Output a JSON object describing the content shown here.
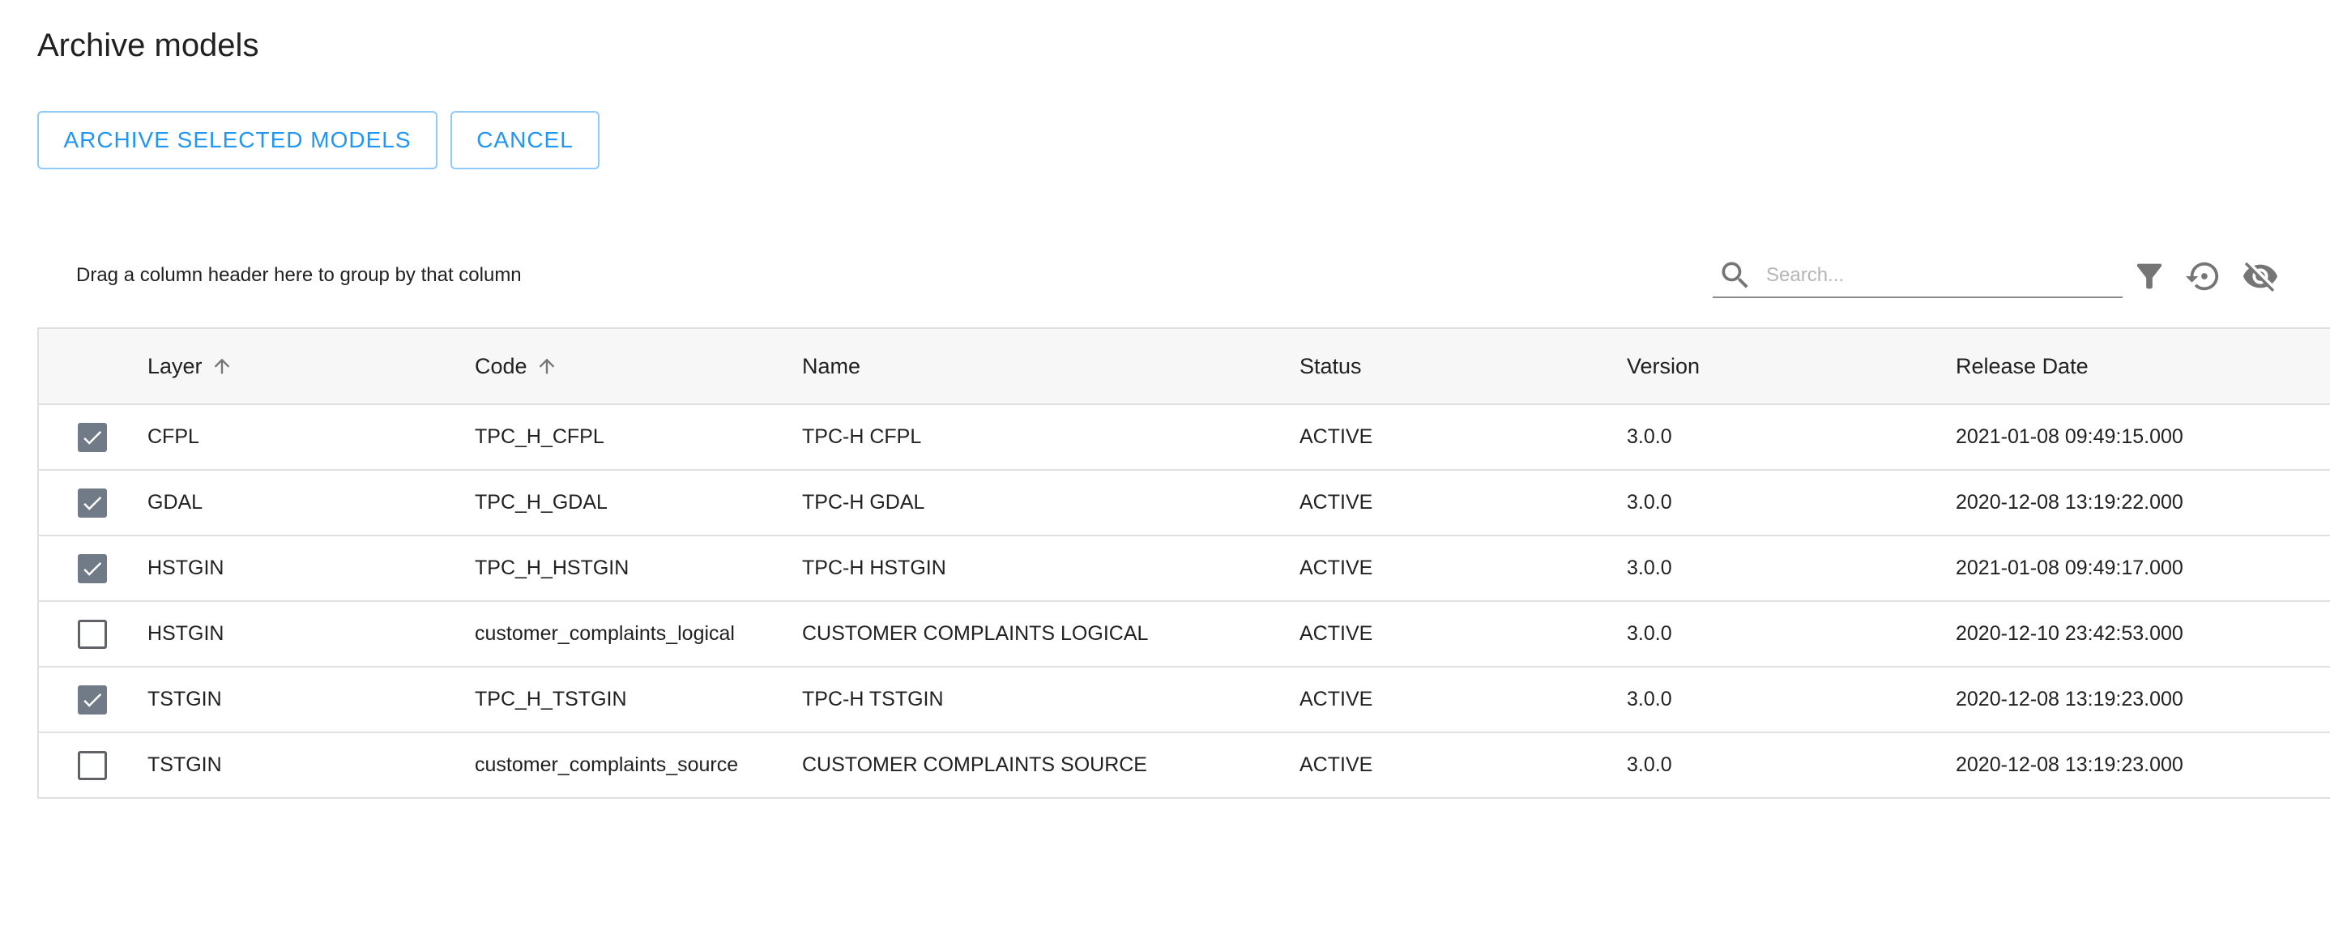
{
  "page": {
    "title": "Archive models"
  },
  "actions": {
    "archive_label": "ARCHIVE SELECTED MODELS",
    "cancel_label": "CANCEL"
  },
  "toolbar": {
    "group_hint": "Drag a column header here to group by that column",
    "search_placeholder": "Search...",
    "search_value": ""
  },
  "colors": {
    "accent": "#2196f3",
    "checkbox_checked": "#717b87",
    "icon": "#757575"
  },
  "icons": {
    "search": "search-icon",
    "filter": "filter-icon",
    "reset": "reset-icon",
    "hide": "visibility-off-icon",
    "sort": "arrow-up-icon",
    "check": "check-icon"
  },
  "table": {
    "columns": [
      {
        "key": "layer",
        "label": "Layer",
        "sorted": "asc"
      },
      {
        "key": "code",
        "label": "Code",
        "sorted": "asc"
      },
      {
        "key": "name",
        "label": "Name"
      },
      {
        "key": "status",
        "label": "Status"
      },
      {
        "key": "version",
        "label": "Version"
      },
      {
        "key": "release",
        "label": "Release Date"
      }
    ],
    "rows": [
      {
        "checked": true,
        "layer": "CFPL",
        "code": "TPC_H_CFPL",
        "name": "TPC-H CFPL",
        "status": "ACTIVE",
        "version": "3.0.0",
        "release": "2021-01-08 09:49:15.000"
      },
      {
        "checked": true,
        "layer": "GDAL",
        "code": "TPC_H_GDAL",
        "name": "TPC-H GDAL",
        "status": "ACTIVE",
        "version": "3.0.0",
        "release": "2020-12-08 13:19:22.000"
      },
      {
        "checked": true,
        "layer": "HSTGIN",
        "code": "TPC_H_HSTGIN",
        "name": "TPC-H HSTGIN",
        "status": "ACTIVE",
        "version": "3.0.0",
        "release": "2021-01-08 09:49:17.000"
      },
      {
        "checked": false,
        "layer": "HSTGIN",
        "code": "customer_complaints_logical",
        "name": "CUSTOMER COMPLAINTS LOGICAL",
        "status": "ACTIVE",
        "version": "3.0.0",
        "release": "2020-12-10 23:42:53.000"
      },
      {
        "checked": true,
        "layer": "TSTGIN",
        "code": "TPC_H_TSTGIN",
        "name": "TPC-H TSTGIN",
        "status": "ACTIVE",
        "version": "3.0.0",
        "release": "2020-12-08 13:19:23.000"
      },
      {
        "checked": false,
        "layer": "TSTGIN",
        "code": "customer_complaints_source",
        "name": "CUSTOMER COMPLAINTS SOURCE",
        "status": "ACTIVE",
        "version": "3.0.0",
        "release": "2020-12-08 13:19:23.000"
      }
    ]
  }
}
